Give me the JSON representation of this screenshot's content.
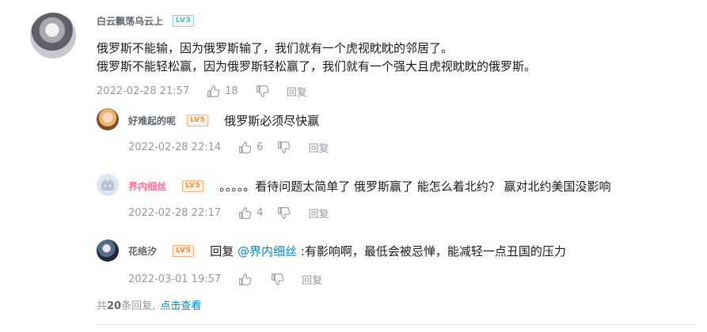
{
  "main_comment": {
    "username": "白云飘荡乌云上",
    "level": "LV3",
    "lines": [
      "俄罗斯不能输，因为俄罗斯输了，我们就有一个虎视眈眈的邻居了。",
      "俄罗斯不能轻松赢，因为俄罗斯轻松赢了，我们就有一个强大且虎视眈眈的俄罗斯。"
    ],
    "time": "2022-02-28 21:57",
    "likes": "18",
    "reply_label": "回复"
  },
  "replies": [
    {
      "username": "好难起的呢",
      "level": "LV5",
      "text": "俄罗斯必须尽快赢",
      "time": "2022-02-28 22:14",
      "likes": "6",
      "reply_label": "回复"
    },
    {
      "username": "界内细丝",
      "level": "LV5",
      "text": "。。。。。看待问题太简单了 俄罗斯赢了 能怎么着北约？ 赢对北约美国没影响",
      "time": "2022-02-28 22:17",
      "likes": "4",
      "reply_label": "回复"
    },
    {
      "username": "花络汐",
      "level": "LV5",
      "reply_prefix": "回复",
      "mention": "@界内细丝",
      "text": ":有影响啊，最低会被忌惮，能减轻一点丑国的压力",
      "time": "2022-03-01 19:57",
      "likes": "",
      "reply_label": "回复"
    }
  ],
  "footer": {
    "prefix": "共",
    "count": "20",
    "suffix": "条回复,",
    "view_label": "点击查看"
  },
  "icons": {
    "like": "thumbs-up-icon",
    "dislike": "thumbs-down-icon"
  },
  "colors": {
    "link": "#008ac5",
    "pink_name": "#fb7299",
    "meta": "#9499a0"
  }
}
